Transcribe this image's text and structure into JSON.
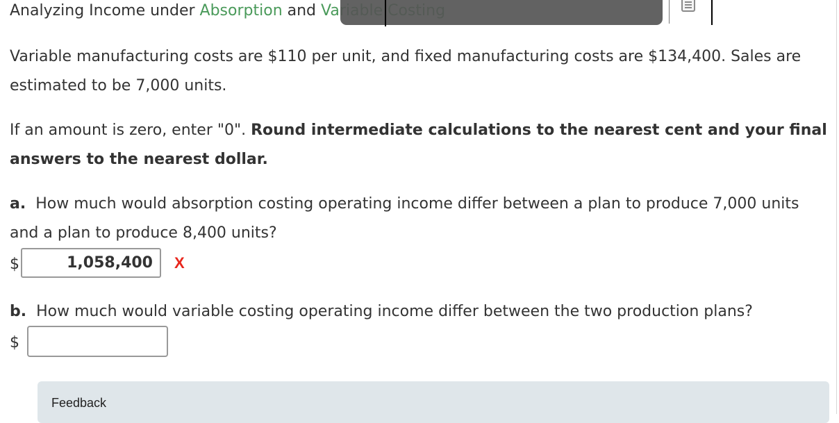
{
  "title": {
    "prefix": "Analyzing Income under ",
    "link1": "Absorption",
    "connector": " and ",
    "link2": "Variable Costing"
  },
  "problem": {
    "statement": "Variable manufacturing costs are $110 per unit, and fixed manufacturing costs are $134,400. Sales are estimated to be 7,000 units.",
    "instruction_plain": "If an amount is zero, enter \"0\". ",
    "instruction_bold": "Round intermediate calculations to the nearest cent and your final answers to the nearest dollar."
  },
  "questions": [
    {
      "label": "a.",
      "text": "How much would absorption costing operating income differ between a plan to produce 7,000 units and a plan to produce 8,400 units?",
      "currency": "$",
      "answer": "1,058,400",
      "status": "incorrect",
      "status_mark": "X"
    },
    {
      "label": "b.",
      "text": "How much would variable costing operating income differ between the two production plans?",
      "currency": "$",
      "answer": ""
    }
  ],
  "feedback": {
    "label": "Feedback"
  },
  "icons": {
    "toolbar": "document-icon",
    "wrong": "x-mark-icon"
  },
  "colors": {
    "link": "#4a9a5a",
    "wrong": "#e8261c",
    "feedback_bg": "#dfe6ea",
    "overlay": "#555555"
  }
}
